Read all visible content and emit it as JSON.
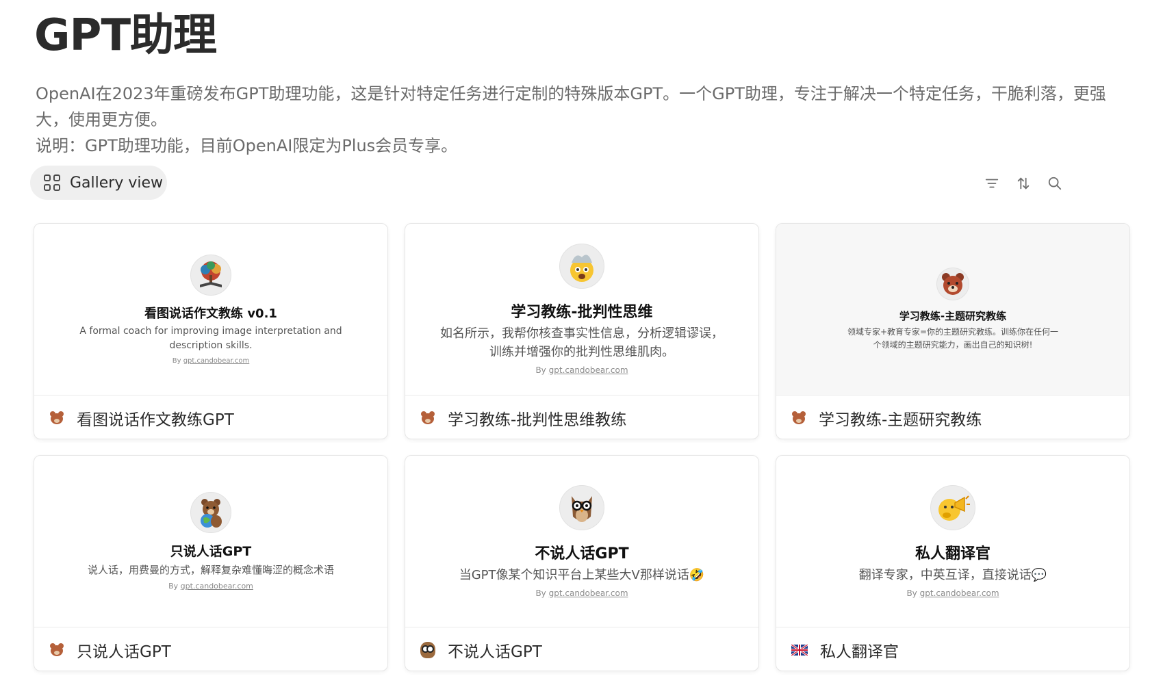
{
  "page": {
    "title": "GPT助理",
    "description": "OpenAI在2023年重磅发布GPT助理功能，这是针对特定任务进行定制的特殊版本GPT。一个GPT助理，专注于解决一个特定任务，干脆利落，更强大，使用更方便。",
    "note": "说明：GPT助理功能，目前OpenAI限定为Plus会员专享。"
  },
  "view": {
    "label": "Gallery view"
  },
  "toolbar": {
    "icons": [
      "filter-icon",
      "sort-icon",
      "search-icon"
    ]
  },
  "cards": [
    {
      "preview_title": "看图说话作文教练 v0.1",
      "preview_desc": "A formal coach for improving image interpretation and description skills.",
      "by_prefix": "By",
      "by_link": "gpt.candobear.com",
      "name": "看图说话作文教练GPT",
      "footer_icon": "bear-icon",
      "avatar_icon": "tree-book-icon"
    },
    {
      "preview_title": "学习教练-批判性思维",
      "preview_desc": "如名所示，我帮你核查事实性信息，分析逻辑谬误，训练并增强你的批判性思维肌肉。",
      "by_prefix": "By",
      "by_link": "gpt.candobear.com",
      "name": "学习教练-批判性思维教练",
      "footer_icon": "bear-icon",
      "avatar_icon": "exploding-head-icon"
    },
    {
      "preview_title": "学习教练-主题研究教练",
      "preview_desc": "领域专家+教育专家=你的主题研究教练。训练你在任何一个领域的主题研究能力，画出自己的知识树!",
      "by_prefix": "",
      "by_link": "",
      "name": "学习教练-主题研究教练",
      "footer_icon": "bear-icon",
      "avatar_icon": "bear-face-icon"
    },
    {
      "preview_title": "只说人话GPT",
      "preview_desc": "说人话，用费曼的方式，解释复杂难懂晦涩的概念术语",
      "by_prefix": "By",
      "by_link": "gpt.candobear.com",
      "name": "只说人话GPT",
      "footer_icon": "bear-icon",
      "avatar_icon": "bear-globe-icon"
    },
    {
      "preview_title": "不说人话GPT",
      "preview_desc": "当GPT像某个知识平台上某些大V那样说话🤣",
      "by_prefix": "By",
      "by_link": "gpt.candobear.com",
      "name": "不说人话GPT",
      "footer_icon": "owl-icon",
      "avatar_icon": "owl-glasses-icon"
    },
    {
      "preview_title": "私人翻译官",
      "preview_desc": "翻译专家，中英互译，直接说话💬",
      "by_prefix": "By",
      "by_link": "gpt.candobear.com",
      "name": "私人翻译官",
      "footer_icon": "uk-flag-icon",
      "avatar_icon": "megaphone-emoji-icon"
    }
  ]
}
